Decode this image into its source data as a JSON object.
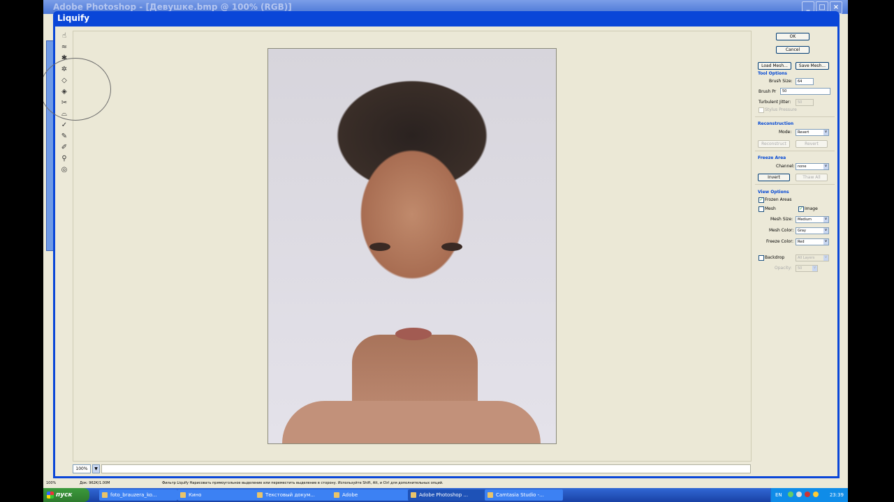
{
  "window": {
    "title": "Adobe Photoshop - [Девушкe.bmp @ 100% (RGB)]"
  },
  "dialog": {
    "title": "Liquify"
  },
  "buttons": {
    "ok": "OK",
    "cancel": "Cancel",
    "load_mesh": "Load Mesh...",
    "save_mesh": "Save Mesh..."
  },
  "tool_options": {
    "heading": "Tool Options",
    "brush_size_label": "Brush Size:",
    "brush_size": "64",
    "brush_pressure_label": "Brush Pr",
    "brush_pressure": "50",
    "turbulent_jitter_label": "Turbulent Jitter:",
    "turbulent_jitter": "50",
    "stylus_label": "Stylus Pressure"
  },
  "reconstruction": {
    "heading": "Reconstruction",
    "mode_label": "Mode:",
    "mode": "Revert",
    "reconstruct": "Reconstruct",
    "revert": "Revert"
  },
  "freeze": {
    "heading": "Freeze Area",
    "channel_label": "Channel:",
    "channel": "none",
    "invert": "Invert",
    "thaw_all": "Thaw All"
  },
  "view_options": {
    "heading": "View Options",
    "frozen_areas": "Frozen Areas",
    "mesh": "Mesh",
    "image": "Image",
    "mesh_size_label": "Mesh Size:",
    "mesh_size": "Medium",
    "mesh_color_label": "Mesh Color:",
    "mesh_color": "Gray",
    "freeze_color_label": "Freeze Color:",
    "freeze_color": "Red",
    "backdrop": "Backdrop",
    "backdrop_value": "All Layers",
    "opacity_label": "Opacity:",
    "opacity": "50"
  },
  "canvas": {
    "zoom": "100%"
  },
  "status": {
    "zoom": "100%",
    "doc": "Док: 962К/1.00M",
    "hint": "Фильтр Liquify   Нарисовать прямоугольное выделение или переместить выделение в сторону. Используйте Shift, Alt, и Ctrl для дополнительных опций."
  },
  "taskbar": {
    "start": "пуск",
    "items": [
      "foto_brauzera_ko...",
      "Кино",
      "Текстовый докум...",
      "Adobe",
      "Adobe Photoshop ...",
      "Camtasia Studio -..."
    ],
    "lang": "EN",
    "clock": "23:39"
  },
  "tools": [
    "warp-tool",
    "turbulence-tool",
    "twirl-cw-tool",
    "twirl-ccw-tool",
    "pucker-tool",
    "bloat-tool",
    "shift-pixels-tool",
    "reflection-tool",
    "reconstruct-tool",
    "freeze-tool",
    "thaw-tool",
    "zoom-tool",
    "hand-tool"
  ],
  "colors": {
    "xp_blue": "#0a46d8",
    "panel_bg": "#ece9d8",
    "section_blue": "#0046d5"
  }
}
